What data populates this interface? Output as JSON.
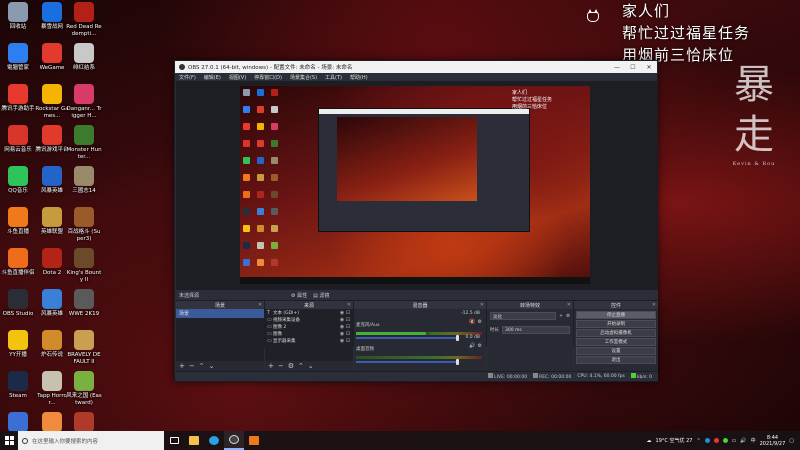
{
  "desktop_icons": [
    {
      "label": "回收站",
      "color": "#8a9bb0"
    },
    {
      "label": "電腦管家",
      "color": "#2d7ff0"
    },
    {
      "label": "腾讯手游助手",
      "color": "#e8392f"
    },
    {
      "label": "网易云音乐",
      "color": "#d8362a"
    },
    {
      "label": "QQ音乐",
      "color": "#2fc35b"
    },
    {
      "label": "斗鱼直播",
      "color": "#f07a1a"
    },
    {
      "label": "斗鱼直播伴侣",
      "color": "#ef6c1a"
    },
    {
      "label": "OBS Studio",
      "color": "#2a2d36"
    },
    {
      "label": "YY开播",
      "color": "#f2c30f"
    },
    {
      "label": "Steam",
      "color": "#1b2a47"
    },
    {
      "label": "SonyVegas",
      "color": "#3c6fd3"
    },
    {
      "label": "暴雪战网",
      "color": "#1a6fe0"
    },
    {
      "label": "WeGame",
      "color": "#e33a2f"
    },
    {
      "label": "Rockstar Games...",
      "color": "#f4b400"
    },
    {
      "label": "腾讯游戏平台",
      "color": "#e03a2c"
    },
    {
      "label": "风暴英雄",
      "color": "#2463c7"
    },
    {
      "label": "英雄联盟",
      "color": "#c59b3c"
    },
    {
      "label": "Dota 2",
      "color": "#b32418"
    },
    {
      "label": "风暴英雄",
      "color": "#3a7fd8"
    },
    {
      "label": "炉石传说",
      "color": "#d08c2a"
    },
    {
      "label": "Tapp Horror...",
      "color": "#c7c2b0"
    },
    {
      "label": "Horizon Zero Dawn",
      "color": "#ef8b3a"
    },
    {
      "label": "Red Dead Redempti...",
      "color": "#b22018"
    },
    {
      "label": "绯红结系",
      "color": "#c8c8c8"
    },
    {
      "label": "Danganr... Trigger H...",
      "color": "#d83a6a"
    },
    {
      "label": "Monster Hunter...",
      "color": "#3c7a30"
    },
    {
      "label": "三國志14",
      "color": "#9a8a6a"
    },
    {
      "label": "百战格斗 (Super3)",
      "color": "#9a5a2a"
    },
    {
      "label": "King's Bounty II",
      "color": "#6a4a2a"
    },
    {
      "label": "WWE 2K19",
      "color": "#5a5a5a"
    },
    {
      "label": "BRAVELY DEFAULT II",
      "color": "#c8a050"
    },
    {
      "label": "风来之国 (Eastward)",
      "color": "#7ab040"
    },
    {
      "label": "破晓传说",
      "color": "#b03a2a"
    }
  ],
  "overlay": {
    "lines": [
      "家人们",
      "帮忙过过福星任务",
      "用烟前三恰床位"
    ]
  },
  "calligraphy": {
    "text": "暴走",
    "small": "Kevin & Rou"
  },
  "obs": {
    "title": "OBS 27.0.1 (64-bit, windows) - 配置文件: 未命名 - 场景: 未命名",
    "menu": [
      "文件(F)",
      "编辑(E)",
      "视图(V)",
      "停靠窗口(D)",
      "场景集合(S)",
      "工具(T)",
      "帮助(H)"
    ],
    "no_source": "未选择源",
    "audio_btn": "属性",
    "filter_btn": "滤镜",
    "docks": {
      "scenes": {
        "title": "场景",
        "items": [
          "场景"
        ]
      },
      "sources": {
        "title": "来源",
        "items": [
          {
            "icon": "T",
            "name": "文本 (GDI+)"
          },
          {
            "icon": "▭",
            "name": "视频采集设备"
          },
          {
            "icon": "▭",
            "name": "图像 2"
          },
          {
            "icon": "▭",
            "name": "图像"
          },
          {
            "icon": "▭",
            "name": "显示器采集"
          }
        ]
      },
      "mixer": {
        "title": "混音器",
        "tracks": [
          {
            "name": "麦克风/Aux",
            "db": "-12.5 dB"
          },
          {
            "name": "桌面音频",
            "db": "0.0 dB"
          }
        ]
      },
      "transitions": {
        "title": "转场特效",
        "type": "淡化",
        "duration_label": "时长",
        "duration": "300 ms"
      },
      "controls": {
        "title": "控件",
        "buttons": [
          "停止直播",
          "开始录制",
          "启动虚拟摄像机",
          "工作室模式",
          "设置",
          "退出"
        ]
      }
    },
    "status": {
      "drop": "LIVE: 00:00:00",
      "rec": "REC: 00:00:00",
      "cpu": "CPU: 4.1%, 60.00 fps",
      "kbps": "kb/s: 0"
    }
  },
  "taskbar": {
    "search_placeholder": "在这里输入你要搜索的内容",
    "weather": "19°C 空气优 27",
    "time": "8:44",
    "date": "2021/9/27",
    "ime": "中"
  }
}
